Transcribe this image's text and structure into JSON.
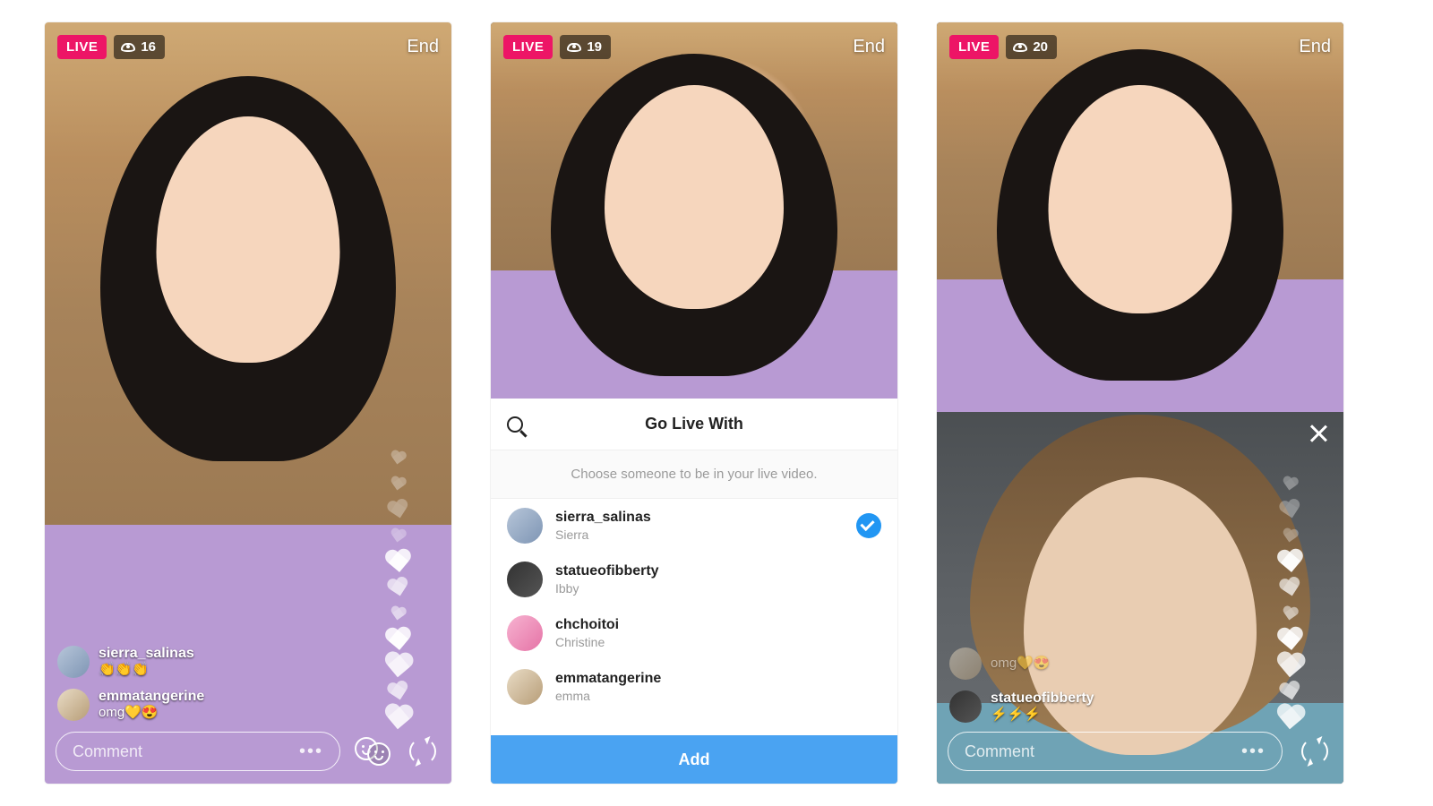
{
  "common": {
    "live_label": "LIVE",
    "end_label": "End",
    "comment_placeholder": "Comment",
    "dots": "•••"
  },
  "screen1": {
    "viewer_count": "16",
    "comments": [
      {
        "user": "sierra_salinas",
        "msg": "👏👏👏"
      },
      {
        "user": "emmatangerine",
        "msg": "omg💛😍"
      }
    ]
  },
  "screen2": {
    "viewer_count": "19",
    "sheet": {
      "title": "Go Live With",
      "subtitle": "Choose someone to be in your live video.",
      "add_label": "Add",
      "users": [
        {
          "username": "sierra_salinas",
          "display": "Sierra",
          "selected": true
        },
        {
          "username": "statueofibberty",
          "display": "Ibby",
          "selected": false
        },
        {
          "username": "chchoitoi",
          "display": "Christine",
          "selected": false
        },
        {
          "username": "emmatangerine",
          "display": "emma",
          "selected": false
        }
      ]
    }
  },
  "screen3": {
    "viewer_count": "20",
    "comments": [
      {
        "user": "",
        "msg": "omg💛😍"
      },
      {
        "user": "statueofibberty",
        "msg": "⚡⚡⚡"
      }
    ]
  }
}
